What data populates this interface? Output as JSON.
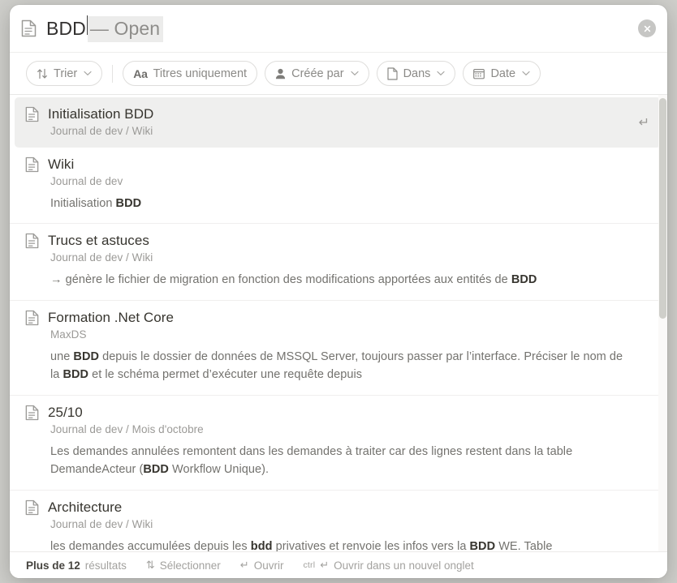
{
  "search": {
    "icon": "document-icon",
    "query": "BDD",
    "suggestion": "— Open",
    "close_icon": "close-circle-icon"
  },
  "filters": [
    {
      "id": "trier",
      "label": "Trier",
      "icon": "sort-arrows-icon",
      "caret": true
    },
    {
      "id": "titres",
      "label": "Titres uniquement",
      "icon": "aa-text-icon",
      "caret": false
    },
    {
      "id": "creee",
      "label": "Créée par",
      "icon": "person-icon",
      "caret": true
    },
    {
      "id": "dans",
      "label": "Dans",
      "icon": "page-icon",
      "caret": true
    },
    {
      "id": "date",
      "label": "Date",
      "icon": "calendar-icon",
      "caret": true
    }
  ],
  "results": [
    {
      "title": "Initialisation BDD",
      "path": "Journal de dev / Wiki",
      "snippet_parts": [],
      "selected": true,
      "enter_hint": "↵"
    },
    {
      "title": "Wiki",
      "path": "Journal de dev",
      "snippet_parts": [
        {
          "t": "Initialisation ",
          "b": false
        },
        {
          "t": "BDD",
          "b": true
        }
      ],
      "selected": false
    },
    {
      "title": "Trucs et astuces",
      "path": "Journal de dev / Wiki",
      "snippet_parts": [
        {
          "t": "→ génère le fichier de migration en fonction des modifications apportées aux entités de ",
          "b": false
        },
        {
          "t": "BDD",
          "b": true
        }
      ],
      "selected": false
    },
    {
      "title": "Formation .Net Core",
      "path": "MaxDS",
      "snippet_parts": [
        {
          "t": "une ",
          "b": false
        },
        {
          "t": "BDD",
          "b": true
        },
        {
          "t": " depuis le dossier de données de MSSQL Server, toujours passer par l’interface. Préciser le nom de la ",
          "b": false
        },
        {
          "t": "BDD",
          "b": true
        },
        {
          "t": " et le schéma permet d’exécuter une requête depuis",
          "b": false
        }
      ],
      "selected": false
    },
    {
      "title": "25/10",
      "path": "Journal de dev / Mois d'octobre",
      "snippet_parts": [
        {
          "t": "Les demandes annulées remontent dans les demandes à traiter car des lignes restent dans la table DemandeActeur (",
          "b": false
        },
        {
          "t": "BDD",
          "b": true
        },
        {
          "t": " Workflow Unique).",
          "b": false
        }
      ],
      "selected": false
    },
    {
      "title": "Architecture",
      "path": "Journal de dev / Wiki",
      "snippet_parts": [
        {
          "t": "les demandes accumulées depuis les ",
          "b": false
        },
        {
          "t": "bdd",
          "b": true
        },
        {
          "t": " privatives et renvoie les infos vers la ",
          "b": false
        },
        {
          "t": "BDD",
          "b": true
        },
        {
          "t": " WE. Table",
          "b": false
        }
      ],
      "selected": false
    }
  ],
  "footer": {
    "count_strong": "Plus de 12",
    "count_label": "résultats",
    "select_glyph": "⇅",
    "select_label": "Sélectionner",
    "open_glyph": "↵",
    "open_label": "Ouvrir",
    "newtab_modifier": "ctrl",
    "newtab_glyph": "↵",
    "newtab_label": "Ouvrir dans un nouvel onglet"
  },
  "colors": {
    "selected_row": "#efefee",
    "suggestion_bg": "#ececeb",
    "text_primary": "#37352f",
    "text_muted": "#9b9a97",
    "scrollbar_thumb": "#cfcfca"
  }
}
